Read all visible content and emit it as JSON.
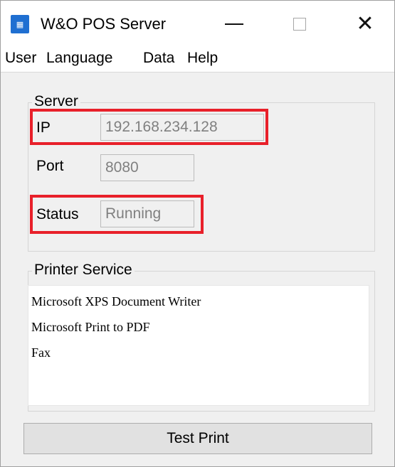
{
  "window": {
    "title": "W&O POS Server",
    "icon_text": "☰",
    "close_glyph": "✕"
  },
  "menu": {
    "items": [
      {
        "label": "User"
      },
      {
        "label": "Language"
      },
      {
        "label": "Data"
      },
      {
        "label": "Help"
      }
    ]
  },
  "server": {
    "legend": "Server",
    "ip_label": "IP",
    "ip_value": "192.168.234.128",
    "port_label": "Port",
    "port_value": "8080",
    "status_label": "Status",
    "status_value": "Running"
  },
  "printer_service": {
    "legend": "Printer Service",
    "printers": [
      "Microsoft XPS Document Writer",
      "Microsoft Print to PDF",
      "Fax"
    ]
  },
  "actions": {
    "test_print_label": "Test Print"
  },
  "colors": {
    "highlight": "#e8202a",
    "app_icon": "#1f6fd1"
  }
}
